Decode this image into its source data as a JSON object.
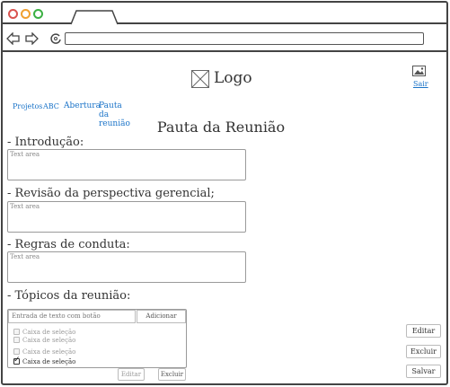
{
  "header": {
    "logo_text": "Logo",
    "logout_label": "Sair"
  },
  "breadcrumb": [
    "Projetos",
    "ABC",
    "Abertura",
    "Pauta da reunião"
  ],
  "page_title": "Pauta da Reunião",
  "sections": [
    {
      "label": "- Introdução:",
      "placeholder": "Text area"
    },
    {
      "label": "- Revisão da perspectiva gerencial;",
      "placeholder": "Text area"
    },
    {
      "label": "- Regras de conduta:",
      "placeholder": "Text area"
    }
  ],
  "topics": {
    "label": "- Tópicos da reunião:",
    "input_placeholder": "Entrada de texto com botão",
    "add_label": "Adicionar",
    "items": [
      {
        "label": "Caixa de seleção",
        "checked": false
      },
      {
        "label": "Caixa de seleção",
        "checked": false
      },
      {
        "label": "Caixa de seleção",
        "checked": false
      },
      {
        "label": "Caixa de seleção",
        "checked": true
      }
    ],
    "edit_label": "Editar",
    "delete_label": "Excluir"
  },
  "side_actions": {
    "edit_label": "Editar",
    "delete_label": "Excluir",
    "save_label": "Salvar"
  },
  "colors": {
    "link": "#1a73c8",
    "dot_red": "#d9534f",
    "dot_orange": "#f0a030",
    "dot_green": "#3cb043"
  }
}
